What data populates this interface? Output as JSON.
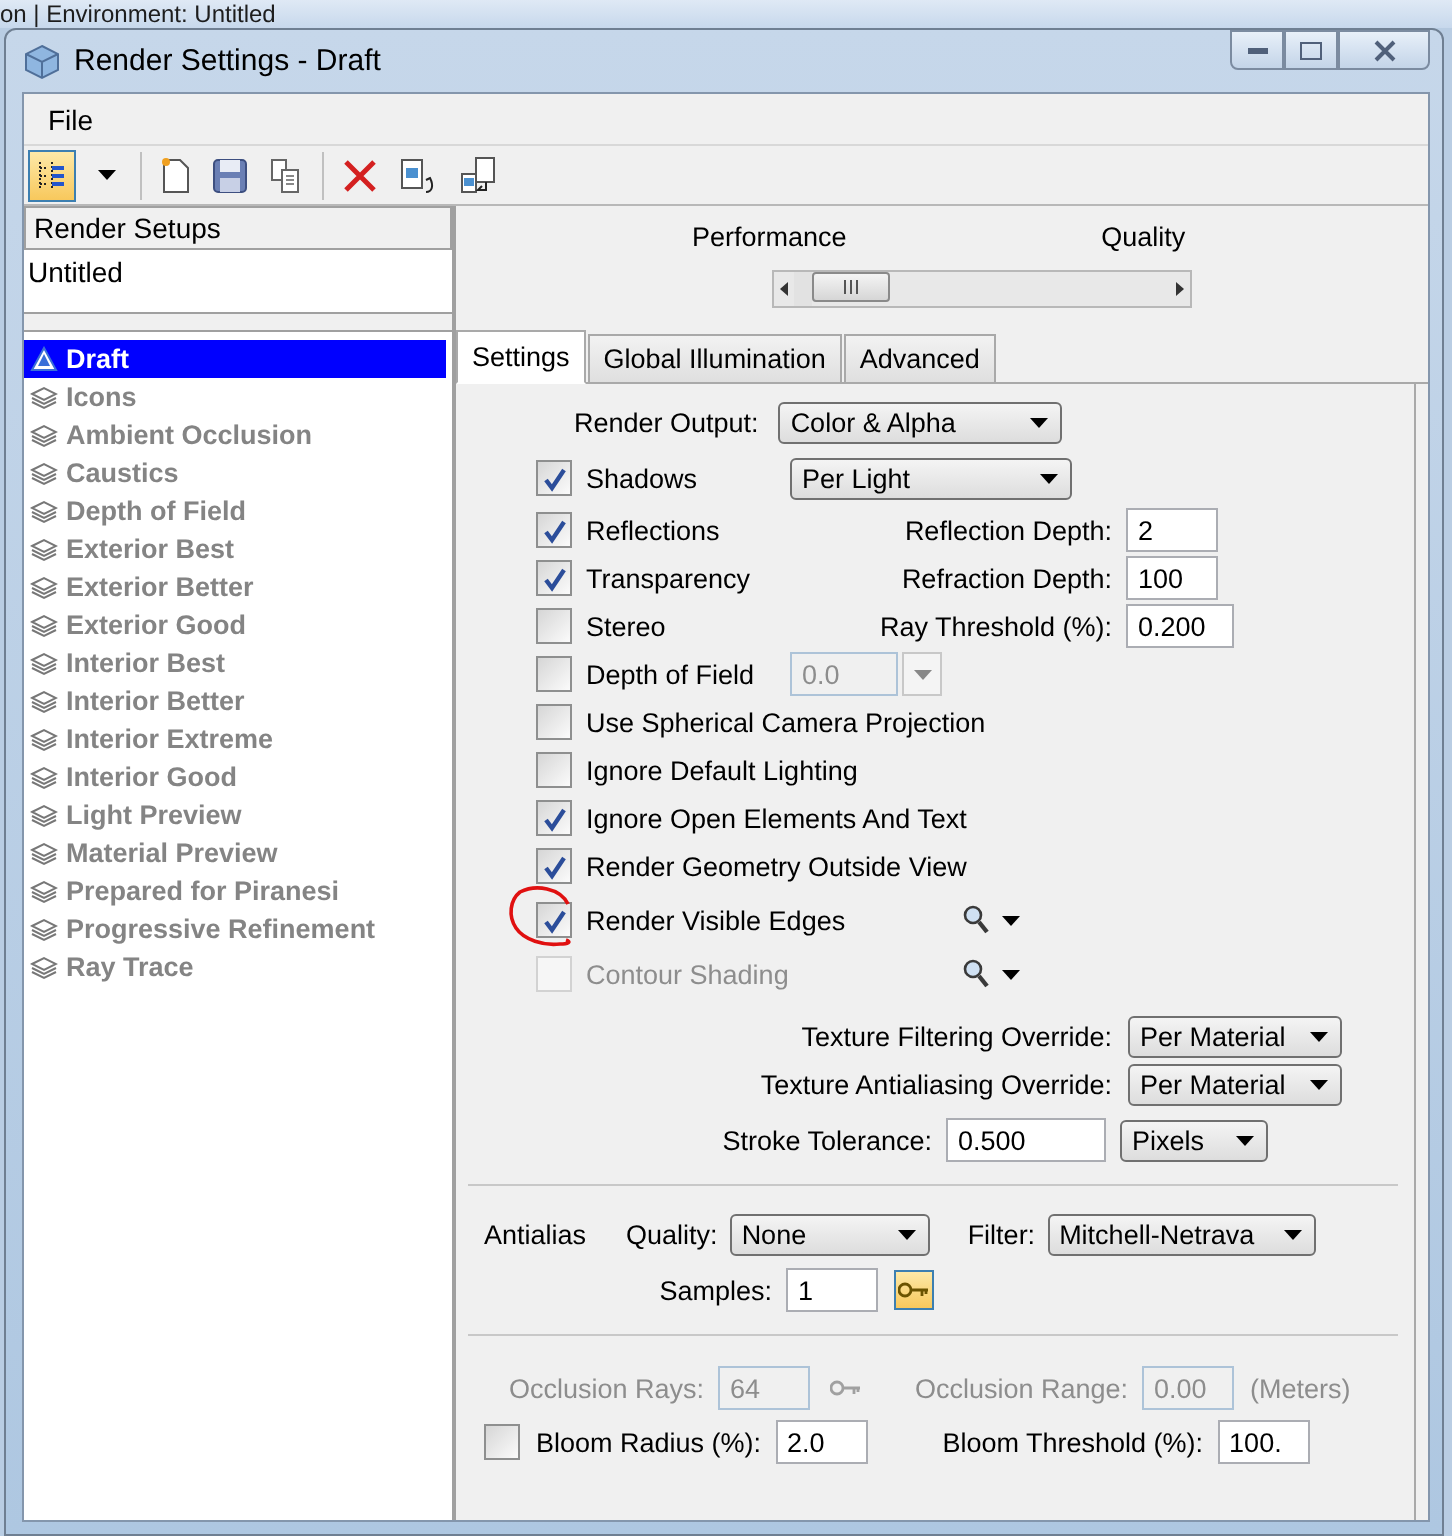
{
  "background_window": {
    "title": "on | Environment: Untitled"
  },
  "window": {
    "title": "Render Settings - Draft"
  },
  "menu": [
    "File"
  ],
  "setups": {
    "header": "Render Setups",
    "file": "Untitled",
    "items": [
      {
        "label": "Draft",
        "kind": "current",
        "selected": true
      },
      {
        "label": "Icons",
        "kind": "preset",
        "selected": false
      },
      {
        "label": "Ambient Occlusion",
        "kind": "preset",
        "selected": false
      },
      {
        "label": "Caustics",
        "kind": "preset",
        "selected": false
      },
      {
        "label": "Depth of Field",
        "kind": "preset",
        "selected": false
      },
      {
        "label": "Exterior Best",
        "kind": "preset",
        "selected": false
      },
      {
        "label": "Exterior Better",
        "kind": "preset",
        "selected": false
      },
      {
        "label": "Exterior Good",
        "kind": "preset",
        "selected": false
      },
      {
        "label": "Interior Best",
        "kind": "preset",
        "selected": false
      },
      {
        "label": "Interior Better",
        "kind": "preset",
        "selected": false
      },
      {
        "label": "Interior Extreme",
        "kind": "preset",
        "selected": false
      },
      {
        "label": "Interior Good",
        "kind": "preset",
        "selected": false
      },
      {
        "label": "Light Preview",
        "kind": "preset",
        "selected": false
      },
      {
        "label": "Material Preview",
        "kind": "preset",
        "selected": false
      },
      {
        "label": "Prepared for Piranesi",
        "kind": "preset",
        "selected": false
      },
      {
        "label": "Progressive Refinement",
        "kind": "preset",
        "selected": false
      },
      {
        "label": "Ray Trace",
        "kind": "preset",
        "selected": false
      }
    ]
  },
  "quality_slider": {
    "left_label": "Performance",
    "right_label": "Quality",
    "level": 0.05
  },
  "tabs": [
    {
      "label": "Settings",
      "selected": true
    },
    {
      "label": "Global Illumination",
      "selected": false
    },
    {
      "label": "Advanced",
      "selected": false
    }
  ],
  "render_output": {
    "label": "Render Output:",
    "value": "Color & Alpha"
  },
  "options": [
    {
      "label": "Shadows",
      "checked": true,
      "disabled": false,
      "circled": false,
      "extra": {
        "kind": "dropdown",
        "value": "Per Light"
      }
    },
    {
      "label": "Reflections",
      "checked": true,
      "disabled": false,
      "circled": false,
      "extra": {
        "kind": "field",
        "label": "Reflection Depth:",
        "value": "2"
      }
    },
    {
      "label": "Transparency",
      "checked": true,
      "disabled": false,
      "circled": false,
      "extra": {
        "kind": "field",
        "label": "Refraction Depth:",
        "value": "100"
      }
    },
    {
      "label": "Stereo",
      "checked": false,
      "disabled": false,
      "circled": false,
      "extra": {
        "kind": "field",
        "label": "Ray Threshold (%):",
        "value": "0.200"
      }
    },
    {
      "label": "Depth of Field",
      "checked": false,
      "disabled": false,
      "circled": false,
      "extra": {
        "kind": "spin",
        "value": "0.0",
        "disabled": true
      }
    },
    {
      "label": "Use Spherical Camera Projection",
      "checked": false,
      "disabled": false,
      "circled": false
    },
    {
      "label": "Ignore Default Lighting",
      "checked": false,
      "disabled": false,
      "circled": false
    },
    {
      "label": "Ignore Open Elements And Text",
      "checked": true,
      "disabled": false,
      "circled": false
    },
    {
      "label": "Render Geometry Outside View",
      "checked": true,
      "disabled": false,
      "circled": false
    },
    {
      "label": "Render Visible Edges",
      "checked": true,
      "disabled": false,
      "circled": true,
      "extra": {
        "kind": "tools"
      }
    },
    {
      "label": "Contour Shading",
      "checked": false,
      "disabled": true,
      "circled": false,
      "extra": {
        "kind": "tools"
      }
    }
  ],
  "overrides": [
    {
      "label": "Texture Filtering Override:",
      "value": "Per Material"
    },
    {
      "label": "Texture Antialiasing Override:",
      "value": "Per Material"
    }
  ],
  "stroke": {
    "label": "Stroke Tolerance:",
    "value": "0.500",
    "unit": "Pixels"
  },
  "antialias": {
    "label": "Antialias",
    "quality_label": "Quality:",
    "quality": "None",
    "filter_label": "Filter:",
    "filter": "Mitchell-Netrava",
    "samples_label": "Samples:",
    "samples": "1"
  },
  "occlusion": {
    "disabled": true,
    "rays_label": "Occlusion Rays:",
    "rays": "64",
    "range_label": "Occlusion Range:",
    "range": "0.00",
    "unit": "(Meters)"
  },
  "bloom": {
    "checked": false,
    "radius_label": "Bloom Radius (%):",
    "radius": "2.0",
    "threshold_label": "Bloom Threshold (%):",
    "threshold": "100."
  }
}
